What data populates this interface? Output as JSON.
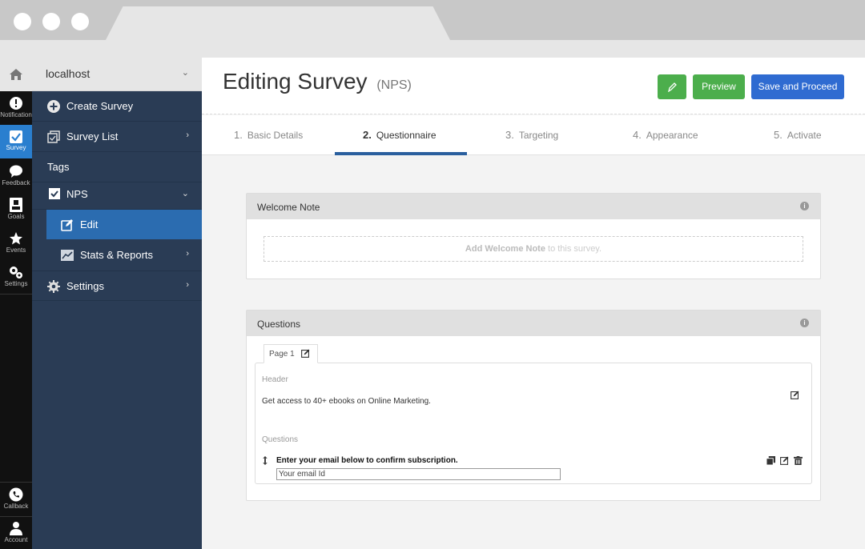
{
  "site": {
    "name": "localhost"
  },
  "rail": {
    "items": [
      {
        "label": "Notification",
        "icon": "notification-icon"
      },
      {
        "label": "Survey",
        "icon": "survey-icon"
      },
      {
        "label": "Feedback",
        "icon": "feedback-icon"
      },
      {
        "label": "Goals",
        "icon": "goals-icon"
      },
      {
        "label": "Events",
        "icon": "star-icon"
      },
      {
        "label": "Settings",
        "icon": "gears-icon"
      },
      {
        "label": "Callback",
        "icon": "phone-icon"
      },
      {
        "label": "Account",
        "icon": "user-icon"
      }
    ]
  },
  "sidebar": {
    "items": [
      {
        "label": "Create Survey"
      },
      {
        "label": "Survey List"
      },
      {
        "label": "Tags"
      },
      {
        "label": "NPS"
      },
      {
        "label": "Edit"
      },
      {
        "label": "Stats & Reports"
      },
      {
        "label": "Settings"
      }
    ]
  },
  "header": {
    "title": "Editing Survey",
    "subtitle": "(NPS)",
    "preview_label": "Preview",
    "save_label": "Save and Proceed"
  },
  "steps": [
    {
      "num": "1.",
      "label": "Basic Details"
    },
    {
      "num": "2.",
      "label": "Questionnaire"
    },
    {
      "num": "3.",
      "label": "Targeting"
    },
    {
      "num": "4.",
      "label": "Appearance"
    },
    {
      "num": "5.",
      "label": "Activate"
    }
  ],
  "welcome": {
    "title": "Welcome Note",
    "add_bold": "Add Welcome Note",
    "add_rest": " to this survey."
  },
  "questions": {
    "title": "Questions",
    "page_tab": "Page 1",
    "header_label": "Header",
    "header_text": "Get access to 40+ ebooks on Online Marketing.",
    "questions_label": "Questions",
    "question_text": "Enter your email below to confirm subscription.",
    "input_placeholder": "Your email Id"
  },
  "colors": {
    "sidebar_bg": "#2a3c55",
    "active_nav": "#2b6cb0",
    "green_button": "#4cae4c",
    "blue_button": "#2f6bd1",
    "step_underline": "#2a5f9e"
  }
}
